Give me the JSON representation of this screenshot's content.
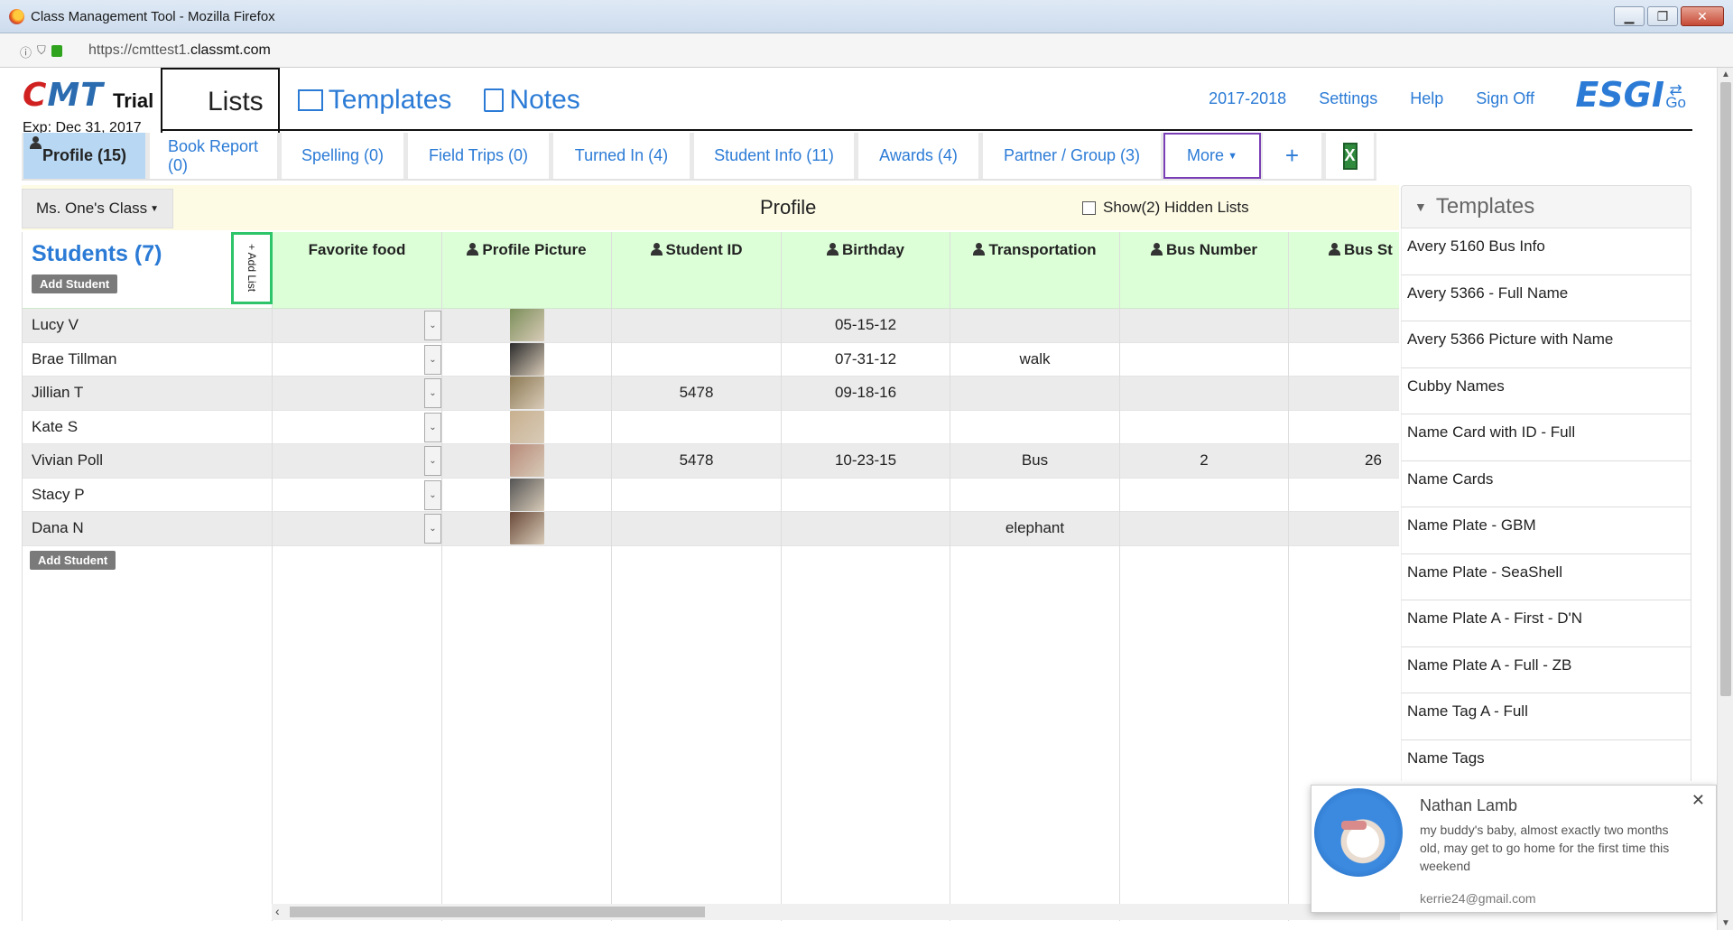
{
  "window": {
    "title": "Class Management Tool - Mozilla Firefox",
    "url_prefix": "https://cmttest1.",
    "url_domain": "classmt.com"
  },
  "logo": {
    "cmt_c": "C",
    "cmt_rest": "MT",
    "trial": "Trial",
    "exp": "Exp: Dec 31, 2017"
  },
  "main_tabs": {
    "lists": "Lists",
    "templates": "Templates",
    "notes": "Notes"
  },
  "top_links": {
    "year": "2017-2018",
    "settings": "Settings",
    "help": "Help",
    "sign_off": "Sign Off",
    "esgi": "ESGI",
    "go": "Go"
  },
  "list_tabs": [
    "Profile (15)",
    "Book Report (0)",
    "Spelling (0)",
    "Field Trips (0)",
    "Turned In (4)",
    "Student Info (11)",
    "Awards (4)",
    "Partner / Group (3)",
    "More",
    "+"
  ],
  "class_bar": {
    "class_name": "Ms. One's Class",
    "title": "Profile",
    "hidden_lists": "Show(2) Hidden Lists"
  },
  "students": {
    "title": "Students (7)",
    "add_student": "Add Student",
    "add_list": "+ Add List",
    "names": [
      "Lucy V",
      "Brae Tillman",
      "Jillian T",
      "Kate S",
      "Vivian Poll",
      "Stacy P",
      "Dana N"
    ]
  },
  "columns": {
    "favorite_food": "Favorite food",
    "profile_picture": "Profile Picture",
    "student_id": "Student ID",
    "birthday": "Birthday",
    "transportation": "Transportation",
    "bus_number": "Bus Number",
    "bus_stop": "Bus St"
  },
  "rows": [
    {
      "student_id": "",
      "birthday": "05-15-12",
      "transportation": "",
      "bus_number": "",
      "bus_stop": ""
    },
    {
      "student_id": "",
      "birthday": "07-31-12",
      "transportation": "walk",
      "bus_number": "",
      "bus_stop": ""
    },
    {
      "student_id": "5478",
      "birthday": "09-18-16",
      "transportation": "",
      "bus_number": "",
      "bus_stop": ""
    },
    {
      "student_id": "",
      "birthday": "",
      "transportation": "",
      "bus_number": "",
      "bus_stop": ""
    },
    {
      "student_id": "5478",
      "birthday": "10-23-15",
      "transportation": "Bus",
      "bus_number": "2",
      "bus_stop": "26"
    },
    {
      "student_id": "",
      "birthday": "",
      "transportation": "",
      "bus_number": "",
      "bus_stop": ""
    },
    {
      "student_id": "",
      "birthday": "",
      "transportation": "elephant",
      "bus_number": "",
      "bus_stop": ""
    }
  ],
  "pic_colors": [
    "#7c8f5a",
    "#2b2b2b",
    "#8d7a55",
    "#c8b08f",
    "#b88a7a",
    "#555555",
    "#6b4a3a"
  ],
  "templates": {
    "title": "Templates",
    "items": [
      "Avery 5160 Bus Info",
      "Avery 5366 - Full Name",
      "Avery 5366 Picture with Name",
      "Cubby Names",
      "Name Card with ID - Full",
      "Name Cards",
      "Name Plate - GBM",
      "Name Plate - SeaShell",
      "Name Plate A - First - D'N",
      "Name Plate A - Full - ZB",
      "Name Tag A - Full",
      "Name Tags"
    ]
  },
  "notification": {
    "name": "Nathan Lamb",
    "message": "my buddy's baby, almost exactly two months old, may get to go home for the first time this weekend",
    "email": "kerrie24@gmail.com"
  }
}
